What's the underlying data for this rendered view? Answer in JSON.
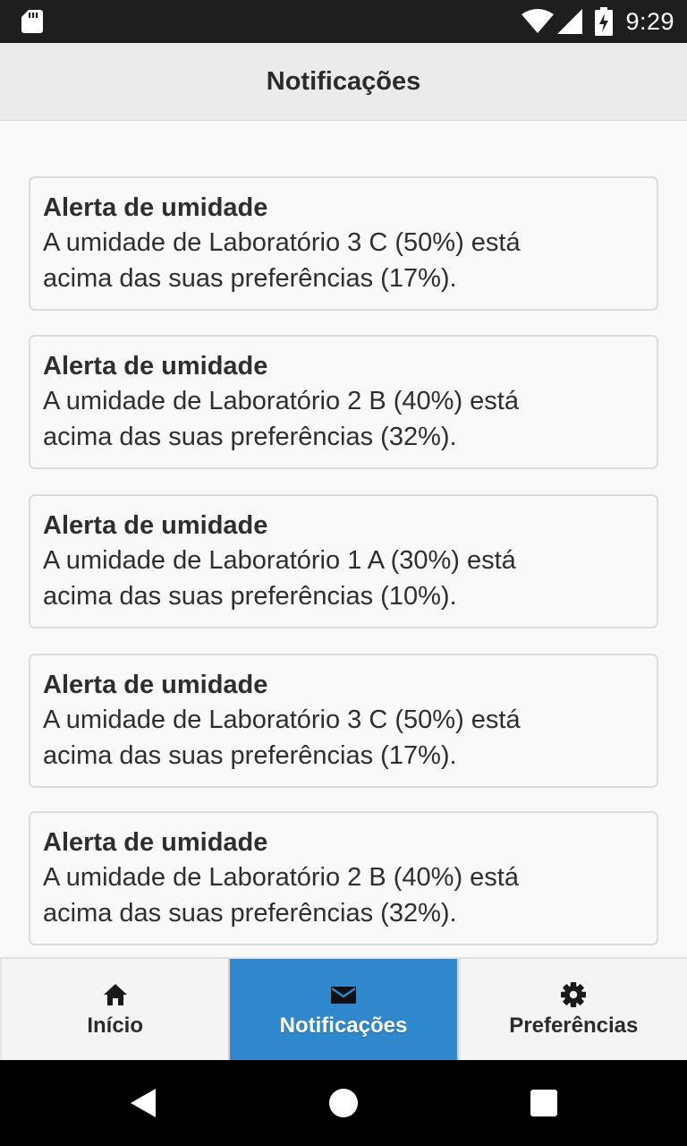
{
  "status_bar": {
    "time": "9:29",
    "icons": [
      "sd-card-icon",
      "wifi-icon",
      "signal-icon",
      "battery-charging-icon"
    ]
  },
  "header": {
    "title": "Notificações"
  },
  "notifications": [
    {
      "title": "Alerta de umidade",
      "line1": "A umidade de Laboratório 3 C (50%) está",
      "line2": "acima das suas preferências (17%)."
    },
    {
      "title": "Alerta de umidade",
      "line1": "A umidade de Laboratório 2 B (40%) está",
      "line2": "acima das suas preferências (32%)."
    },
    {
      "title": "Alerta de umidade",
      "line1": "A umidade de Laboratório 1 A (30%) está",
      "line2": "acima das suas preferências (10%)."
    },
    {
      "title": "Alerta de umidade",
      "line1": "A umidade de Laboratório 3 C (50%) está",
      "line2": "acima das suas preferências (17%)."
    },
    {
      "title": "Alerta de umidade",
      "line1": "A umidade de Laboratório 2 B (40%) está",
      "line2": "acima das suas preferências (32%)."
    }
  ],
  "tabs": [
    {
      "label": "Início",
      "icon": "home-icon",
      "active": false
    },
    {
      "label": "Notificações",
      "icon": "envelope-icon",
      "active": true
    },
    {
      "label": "Preferências",
      "icon": "gear-icon",
      "active": false
    }
  ],
  "colors": {
    "active_tab": "#2f87cc",
    "header_bg": "#ebebeb",
    "status_bar_bg": "#1e1e1e"
  }
}
